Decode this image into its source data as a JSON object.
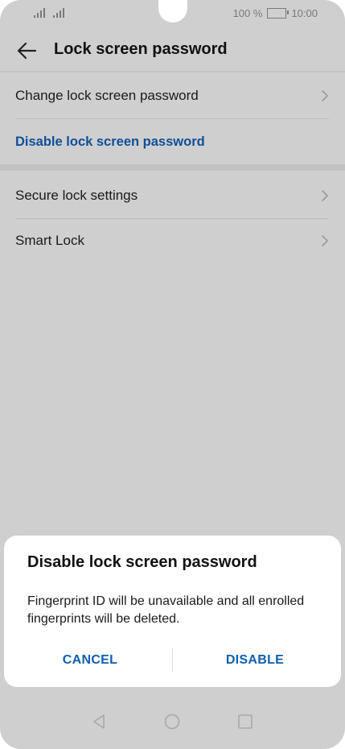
{
  "status_bar": {
    "battery_text": "100 %",
    "time": "10:00",
    "icons": [
      "signal-icon",
      "signal-icon",
      "battery-icon"
    ]
  },
  "header": {
    "title": "Lock screen password",
    "back_icon": "arrow-left-icon"
  },
  "settings": {
    "items": [
      {
        "label": "Change lock screen password",
        "icon": "chevron-right-icon"
      },
      {
        "label": "Disable lock screen password"
      },
      {
        "label": "Secure lock settings",
        "icon": "chevron-right-icon"
      },
      {
        "label": "Smart Lock",
        "icon": "chevron-right-icon"
      }
    ]
  },
  "dialog": {
    "title": "Disable lock screen password",
    "message": "Fingerprint ID will be unavailable and all enrolled fingerprints will be deleted.",
    "cancel_label": "CANCEL",
    "confirm_label": "DISABLE"
  },
  "nav_bar": {
    "icons": [
      "nav-back-icon",
      "nav-home-icon",
      "nav-recents-icon"
    ]
  },
  "colors": {
    "accent": "#0f5fae",
    "link": "#0f4f9a",
    "scrim_background": "#cfcfcf",
    "dialog_background": "#ffffff"
  }
}
